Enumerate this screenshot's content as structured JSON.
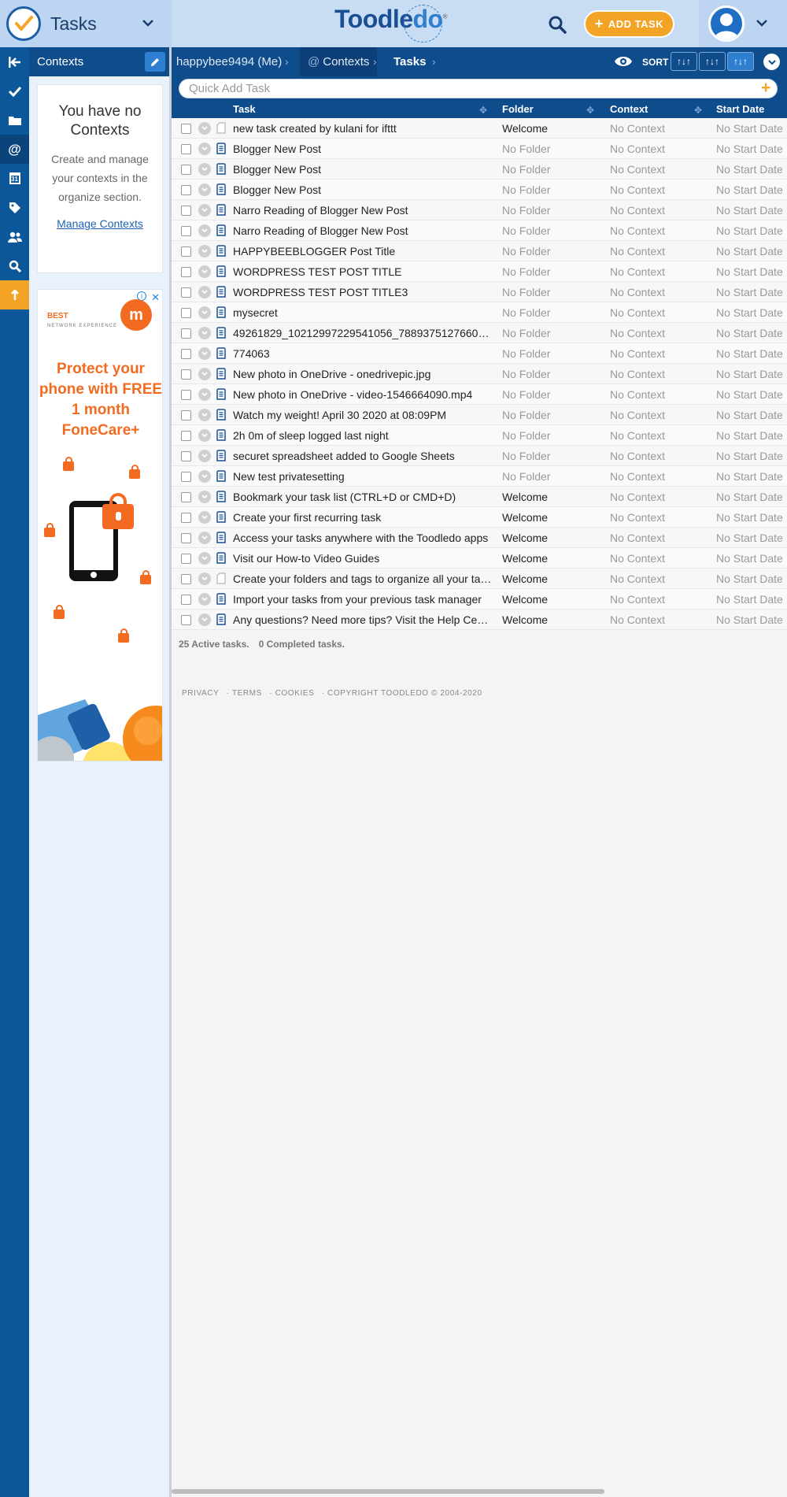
{
  "header": {
    "app_name": "Tasks",
    "brand_prefix": "Toodle",
    "brand_suffix": "do",
    "brand_mark": "®",
    "add_task_label": "ADD TASK"
  },
  "rail": {
    "items": [
      {
        "icon": "collapse-icon"
      },
      {
        "icon": "check-icon"
      },
      {
        "icon": "folder-icon"
      },
      {
        "icon": "at-icon"
      },
      {
        "icon": "calendar-icon",
        "text": "31"
      },
      {
        "icon": "tag-icon"
      },
      {
        "icon": "people-icon"
      },
      {
        "icon": "search-icon"
      },
      {
        "icon": "upgrade-icon"
      }
    ]
  },
  "panel": {
    "title": "Contexts",
    "empty_title": "You have no Contexts",
    "empty_text": "Create and manage your contexts in the organize section.",
    "manage_link": "Manage Contexts"
  },
  "ad": {
    "brand_line": "BEST",
    "brand_sub": "NETWORK EXPERIENCE",
    "logo_letter": "m",
    "headline": "Protect your phone with FREE 1 month FoneCare+",
    "close": "✕",
    "info": "i"
  },
  "breadcrumb": {
    "user": "happybee9494 (Me)",
    "contexts": "Contexts",
    "tasks": "Tasks"
  },
  "toolbar": {
    "sort_label": "SORT",
    "sort_buttons": [
      "↑↓↑",
      "↑↓↑",
      "↑↓↑"
    ]
  },
  "quick_add": {
    "placeholder": "Quick Add Task",
    "plus": "+"
  },
  "table": {
    "columns": {
      "task": "Task",
      "folder": "Folder",
      "context": "Context",
      "start": "Start Date"
    },
    "rows": [
      {
        "task": "new task created by kulani for ifttt",
        "folder": "Welcome",
        "context": "No Context",
        "start": "No Start Date",
        "note": false
      },
      {
        "task": "Blogger New Post",
        "folder": "No Folder",
        "context": "No Context",
        "start": "No Start Date",
        "note": true
      },
      {
        "task": "Blogger New Post",
        "folder": "No Folder",
        "context": "No Context",
        "start": "No Start Date",
        "note": true
      },
      {
        "task": "Blogger New Post",
        "folder": "No Folder",
        "context": "No Context",
        "start": "No Start Date",
        "note": true
      },
      {
        "task": "Narro Reading of Blogger New Post",
        "folder": "No Folder",
        "context": "No Context",
        "start": "No Start Date",
        "note": true
      },
      {
        "task": "Narro Reading of Blogger New Post",
        "folder": "No Folder",
        "context": "No Context",
        "start": "No Start Date",
        "note": true
      },
      {
        "task": "HAPPYBEEBLOGGER Post Title",
        "folder": "No Folder",
        "context": "No Context",
        "start": "No Start Date",
        "note": true
      },
      {
        "task": "WORDPRESS TEST POST TITLE",
        "folder": "No Folder",
        "context": "No Context",
        "start": "No Start Date",
        "note": true
      },
      {
        "task": "WORDPRESS TEST POST TITLE3",
        "folder": "No Folder",
        "context": "No Context",
        "start": "No Start Date",
        "note": true
      },
      {
        "task": "mysecret",
        "folder": "No Folder",
        "context": "No Context",
        "start": "No Start Date",
        "note": true
      },
      {
        "task": "49261829_10212997229541056_7889375127660…",
        "folder": "No Folder",
        "context": "No Context",
        "start": "No Start Date",
        "note": true
      },
      {
        "task": "774063",
        "folder": "No Folder",
        "context": "No Context",
        "start": "No Start Date",
        "note": true
      },
      {
        "task": "New photo in OneDrive - onedrivepic.jpg",
        "folder": "No Folder",
        "context": "No Context",
        "start": "No Start Date",
        "note": true
      },
      {
        "task": "New photo in OneDrive - video-1546664090.mp4",
        "folder": "No Folder",
        "context": "No Context",
        "start": "No Start Date",
        "note": true
      },
      {
        "task": "Watch my weight! April 30 2020 at 08:09PM",
        "folder": "No Folder",
        "context": "No Context",
        "start": "No Start Date",
        "note": true
      },
      {
        "task": "2h 0m of sleep logged last night",
        "folder": "No Folder",
        "context": "No Context",
        "start": "No Start Date",
        "note": true
      },
      {
        "task": "securet spreadsheet added to Google Sheets",
        "folder": "No Folder",
        "context": "No Context",
        "start": "No Start Date",
        "note": true
      },
      {
        "task": "New test privatesetting",
        "folder": "No Folder",
        "context": "No Context",
        "start": "No Start Date",
        "note": true
      },
      {
        "task": "Bookmark your task list (CTRL+D or CMD+D)",
        "folder": "Welcome",
        "context": "No Context",
        "start": "No Start Date",
        "note": true
      },
      {
        "task": "Create your first recurring task",
        "folder": "Welcome",
        "context": "No Context",
        "start": "No Start Date",
        "note": true
      },
      {
        "task": "Access your tasks anywhere with the Toodledo apps",
        "folder": "Welcome",
        "context": "No Context",
        "start": "No Start Date",
        "note": true
      },
      {
        "task": "Visit our How-to Video Guides",
        "folder": "Welcome",
        "context": "No Context",
        "start": "No Start Date",
        "note": true
      },
      {
        "task": "Create your folders and tags to organize all your ta…",
        "folder": "Welcome",
        "context": "No Context",
        "start": "No Start Date",
        "note": false
      },
      {
        "task": "Import your tasks from your previous task manager",
        "folder": "Welcome",
        "context": "No Context",
        "start": "No Start Date",
        "note": true
      },
      {
        "task": "Any questions? Need more tips? Visit the Help Ce…",
        "folder": "Welcome",
        "context": "No Context",
        "start": "No Start Date",
        "note": true
      }
    ]
  },
  "summary": {
    "active": "25 Active tasks.",
    "completed": "0 Completed tasks."
  },
  "footer": {
    "privacy": "PRIVACY",
    "terms": "· TERMS",
    "cookies": "· COOKIES",
    "copyright": "· COPYRIGHT TOODLEDO © 2004-2020"
  },
  "colors": {
    "nav_blue": "#0f4c8c",
    "rail_blue": "#0c5799",
    "accent_orange": "#f4a425",
    "header_light": "#c8dcf3"
  }
}
